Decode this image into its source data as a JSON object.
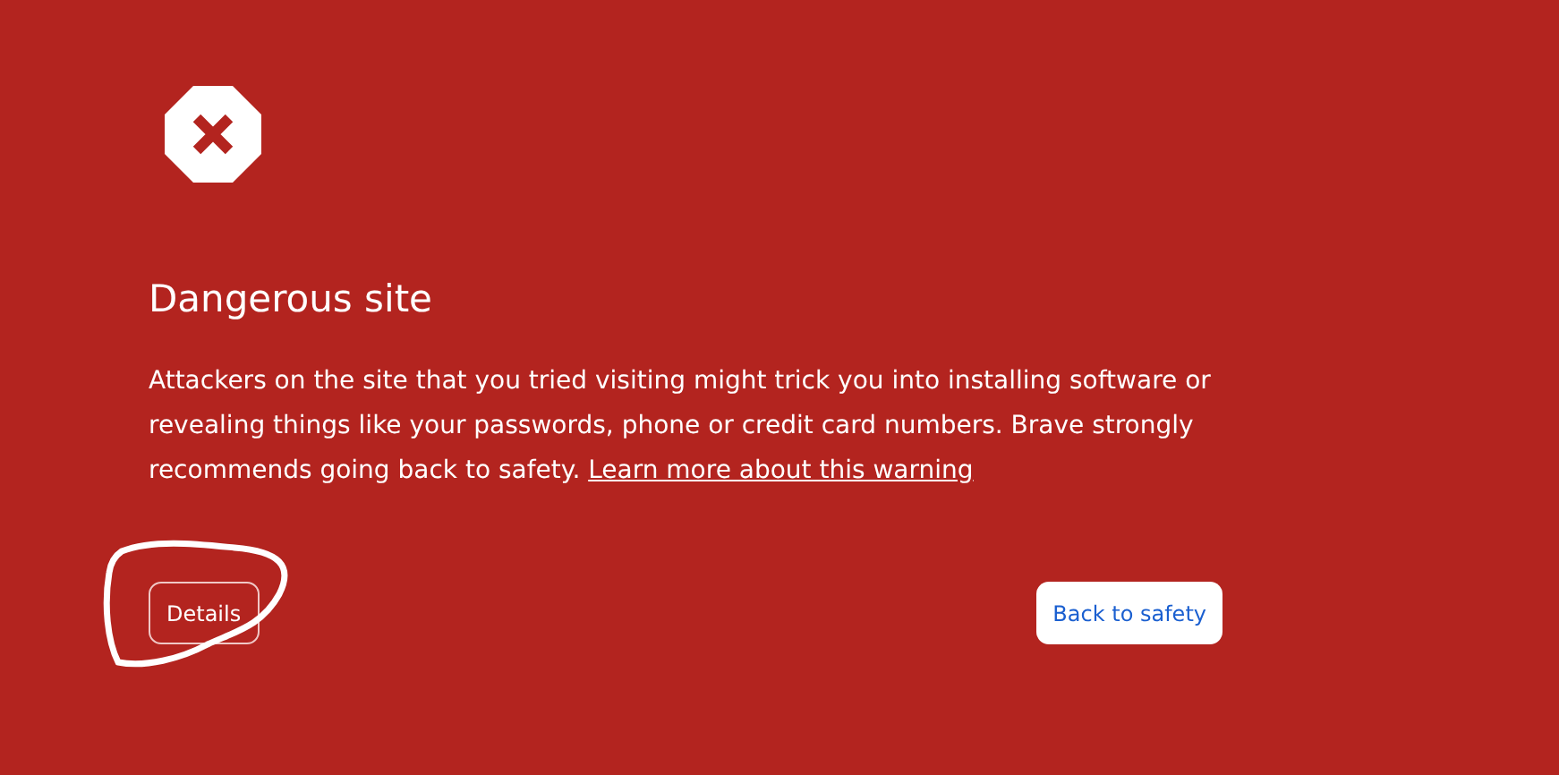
{
  "heading": "Dangerous site",
  "message": "Attackers on the site that you tried visiting might trick you into installing software or revealing things like your passwords, phone or credit card numbers. Brave strongly recommends going back to safety.",
  "link": "Learn more about this warning",
  "buttons": [
    {
      "label": "Details",
      "kind": "secondary"
    },
    {
      "label": "Back to safety",
      "kind": "primary"
    }
  ]
}
